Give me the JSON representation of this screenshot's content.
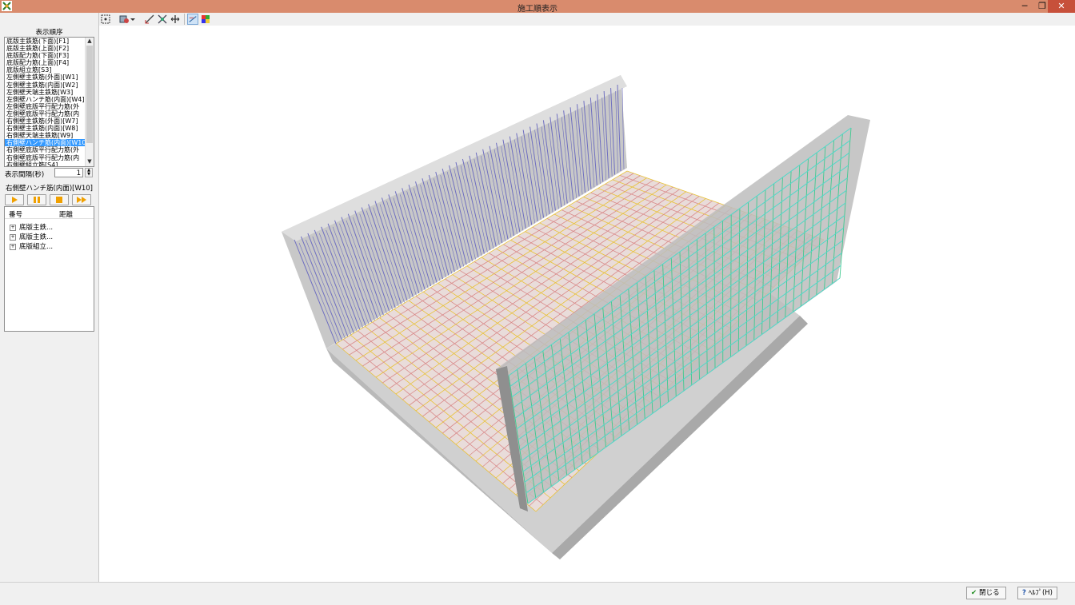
{
  "window": {
    "title": "施工順表示",
    "minimize": "─",
    "restore": "❐",
    "close": "✕"
  },
  "left_panel": {
    "order_header": "表示順序",
    "order_items": [
      "底版主鉄筋(下面)[F1]",
      "底版主鉄筋(上面)[F2]",
      "底版配力筋(下面)[F3]",
      "底版配力筋(上面)[F4]",
      "底版組立筋[S3]",
      "左側壁主鉄筋(外面)[W1]",
      "左側壁主鉄筋(内面)[W2]",
      "左側壁天端主鉄筋[W3]",
      "左側壁ハンチ筋(内面)[W4]",
      "左側壁底版平行配力筋(外",
      "左側壁底版平行配力筋(内",
      "右側壁主鉄筋(外面)[W7]",
      "右側壁主鉄筋(内面)[W8]",
      "右側壁天端主鉄筋[W9]",
      "右側壁ハンチ筋(内面)[W10",
      "右側壁底版平行配力筋(外",
      "右側壁底版平行配力筋(内",
      "右側壁組立筋[S4]"
    ],
    "selected_index": 14,
    "interval_label": "表示間隔(秒)",
    "interval_value": "1",
    "current_item": "右側壁ハンチ筋(内面)[W10]",
    "tree_columns": [
      "番号",
      "距離"
    ],
    "tree_nodes": [
      "底版主鉄...",
      "底版主鉄...",
      "底版組立..."
    ],
    "tree_expander": "+"
  },
  "icons": {
    "play": "play-icon",
    "pause": "pause-icon",
    "stop": "stop-icon",
    "fast_forward": "fast-forward-icon"
  },
  "footer": {
    "close_label": "閉じる",
    "close_icon": "✔",
    "help_label": "ﾍﾙﾌﾟ(H)",
    "help_icon": "?"
  },
  "colors": {
    "titlebar": "#d98b6d",
    "concrete": "#c4c4c4",
    "left_rebar": "#6f6fc0",
    "right_rebar": "#3ec98f",
    "slab_rebar_a": "#e8c23a",
    "slab_rebar_b": "#d98a8a"
  }
}
